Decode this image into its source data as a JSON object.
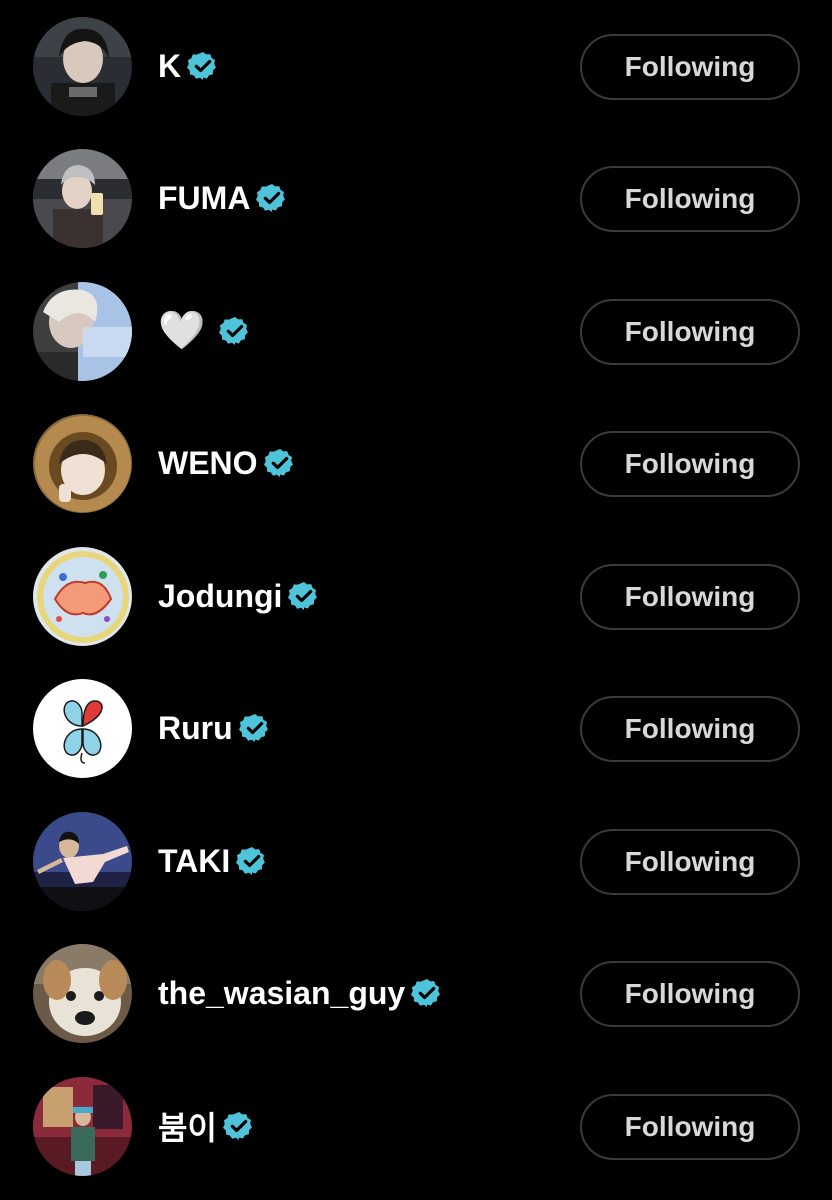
{
  "following_list": [
    {
      "name": "K",
      "button_label": "Following",
      "verified": true,
      "avatar_icon": "avatar-photo"
    },
    {
      "name": "FUMA",
      "button_label": "Following",
      "verified": true,
      "avatar_icon": "avatar-photo"
    },
    {
      "name": "🤍",
      "button_label": "Following",
      "verified": true,
      "avatar_icon": "avatar-photo"
    },
    {
      "name": "WENO",
      "button_label": "Following",
      "verified": true,
      "avatar_icon": "avatar-photo"
    },
    {
      "name": "Jodungi",
      "button_label": "Following",
      "verified": true,
      "avatar_icon": "avatar-drawing"
    },
    {
      "name": "Ruru",
      "button_label": "Following",
      "verified": true,
      "avatar_icon": "avatar-clover-logo"
    },
    {
      "name": "TAKI",
      "button_label": "Following",
      "verified": true,
      "avatar_icon": "avatar-photo"
    },
    {
      "name": "the_wasian_guy",
      "button_label": "Following",
      "verified": true,
      "avatar_icon": "avatar-dog-photo"
    },
    {
      "name": "붐이",
      "button_label": "Following",
      "verified": true,
      "avatar_icon": "avatar-photo"
    }
  ],
  "colors": {
    "background": "#000000",
    "verified_badge": "#4fc3d9",
    "button_border": "#3a3a3c",
    "button_text": "#d8d8d8",
    "name_text": "#ffffff"
  }
}
